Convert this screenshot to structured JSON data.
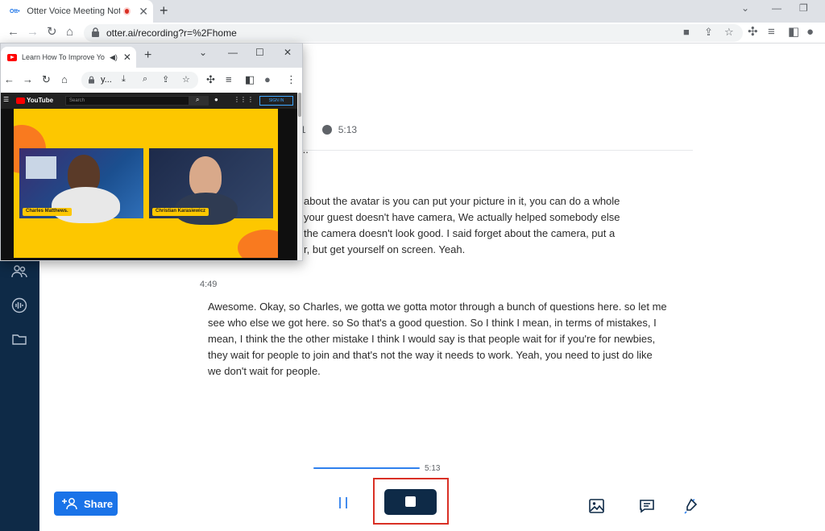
{
  "browser": {
    "tab_title": "Otter Voice Meeting Notes -",
    "favicon_text": "Ott•",
    "url": "otter.ai/recording?r=%2Fhome"
  },
  "popup": {
    "tab_title": "Learn How To Improve Yo",
    "url": "y...",
    "youtube": {
      "logo": "YouTube",
      "search_placeholder": "Search",
      "signin_label": "SIGN IN",
      "participants": [
        "Charles Matthews.",
        "Christian Karasiewicz"
      ]
    }
  },
  "transcript": {
    "meta_left": "1",
    "duration": "5:13",
    "cut_line": "...",
    "para1_lines": [
      "about the avatar is you can put your picture in it, you can do a whole",
      "your guest doesn't have camera, We actually helped somebody else",
      "the camera doesn't look good. I said forget about the camera, put a",
      "r, but get yourself on screen. Yeah."
    ],
    "timestamp2": "4:49",
    "para2": "Awesome. Okay, so Charles, we gotta we gotta motor through a bunch of questions here. so let me see who else we got here. so So that's a good question. So I think I mean, in terms of mistakes, I mean, I think the the other mistake I think I would say is that people wait for if you're for newbies, they wait for people to join and that's not the way it needs to work. Yeah, you need to just do like we don't wait for people."
  },
  "controls": {
    "progress_time": "5:13",
    "share_label": "Share"
  },
  "colors": {
    "sidebar": "#0e2a47",
    "accent": "#1a73e8",
    "highlight": "#d93025"
  }
}
